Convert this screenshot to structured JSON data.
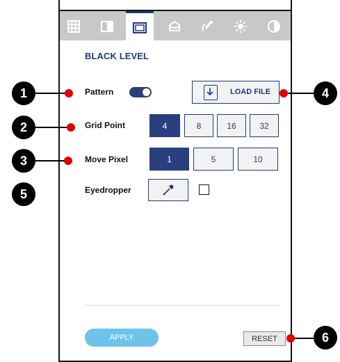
{
  "toolbar": {
    "tools": [
      {
        "icon": "grid-icon",
        "active": false
      },
      {
        "icon": "half-panel-icon",
        "active": false
      },
      {
        "icon": "black-level-icon",
        "active": true
      },
      {
        "icon": "bucket-icon",
        "active": false
      },
      {
        "icon": "brush-icon",
        "active": false
      },
      {
        "icon": "brightness-icon",
        "active": false
      },
      {
        "icon": "contrast-icon",
        "active": false
      }
    ]
  },
  "panel": {
    "title": "BLACK LEVEL",
    "pattern": {
      "label": "Pattern",
      "enabled": true
    },
    "load_file_label": "LOAD FILE",
    "grid_point": {
      "label": "Grid Point",
      "options": [
        "4",
        "8",
        "16",
        "32"
      ],
      "selected": "4"
    },
    "move_pixel": {
      "label": "Move Pixel",
      "options": [
        "1",
        "5",
        "10"
      ],
      "selected": "1"
    },
    "eyedropper": {
      "label": "Eyedropper",
      "checked": false
    },
    "apply_label": "APPLY",
    "reset_label": "RESET"
  },
  "callouts": [
    "1",
    "2",
    "3",
    "4",
    "5",
    "6"
  ],
  "colors": {
    "accent": "#2a3f7f",
    "apply": "#6ec3ea",
    "callout_dot": "#e00000"
  }
}
